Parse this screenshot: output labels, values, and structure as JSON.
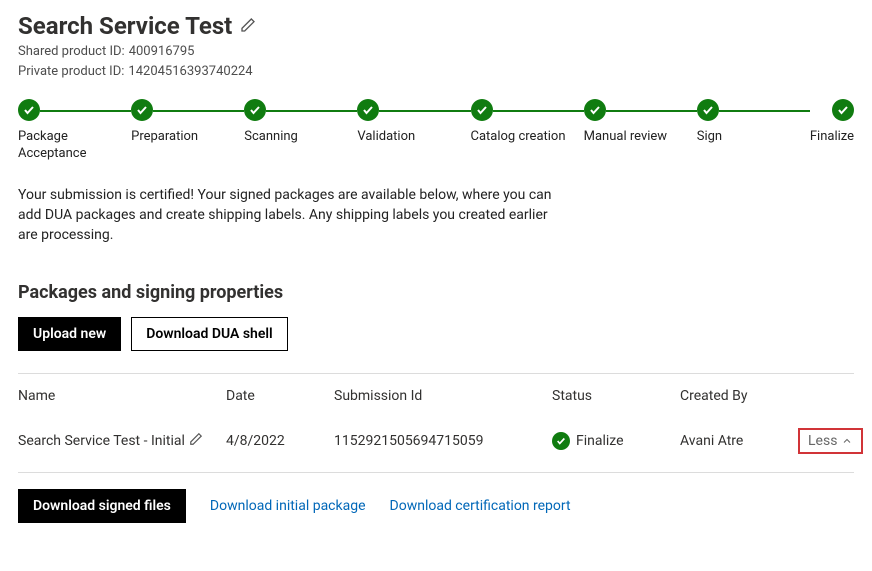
{
  "header": {
    "title": "Search Service Test",
    "shared_label": "Shared product ID:",
    "shared_value": "400916795",
    "private_label": "Private product ID:",
    "private_value": "14204516393740224"
  },
  "stepper": {
    "steps": [
      {
        "label": "Package Acceptance"
      },
      {
        "label": "Preparation"
      },
      {
        "label": "Scanning"
      },
      {
        "label": "Validation"
      },
      {
        "label": "Catalog creation"
      },
      {
        "label": "Manual review"
      },
      {
        "label": "Sign"
      },
      {
        "label": "Finalize"
      }
    ]
  },
  "status_message": "Your submission is certified! Your signed packages are available below, where you can add DUA packages and create shipping labels. Any shipping labels you created earlier are processing.",
  "section": {
    "title": "Packages and signing properties",
    "upload_label": "Upload new",
    "download_dua_label": "Download DUA shell"
  },
  "table": {
    "columns": {
      "name": "Name",
      "date": "Date",
      "submission_id": "Submission Id",
      "status": "Status",
      "created_by": "Created By"
    },
    "rows": [
      {
        "name": "Search Service Test - Initial",
        "date": "4/8/2022",
        "submission_id": "1152921505694715059",
        "status": "Finalize",
        "created_by": "Avani Atre",
        "toggle_label": "Less"
      }
    ]
  },
  "actions": {
    "download_signed": "Download signed files",
    "download_initial": "Download initial package",
    "download_cert": "Download certification report"
  },
  "colors": {
    "success": "#107c10",
    "link": "#0067b8",
    "highlight_border": "#d13438"
  }
}
